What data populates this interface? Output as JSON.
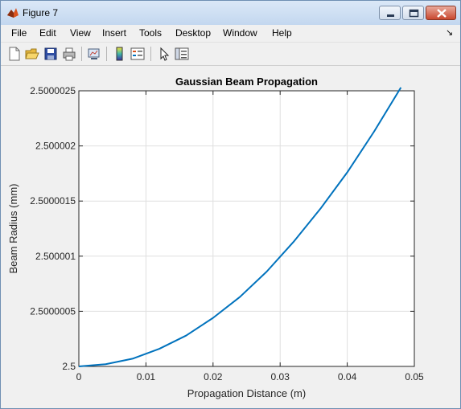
{
  "window": {
    "title": "Figure 7",
    "icon": "matlab-icon",
    "controls": [
      "minimize-icon",
      "maximize-icon",
      "close-icon"
    ]
  },
  "menubar": {
    "items": [
      "File",
      "Edit",
      "View",
      "Insert",
      "Tools",
      "Desktop",
      "Window",
      "Help"
    ],
    "dock_arrow": "↘"
  },
  "toolbar": {
    "buttons": [
      {
        "name": "new-figure-icon"
      },
      {
        "name": "open-file-icon"
      },
      {
        "name": "save-figure-icon"
      },
      {
        "name": "print-figure-icon"
      },
      {
        "name": "link-plot-icon"
      },
      {
        "name": "insert-colorbar-icon"
      },
      {
        "name": "insert-legend-icon"
      },
      {
        "name": "edit-plot-arrow-icon"
      },
      {
        "name": "show-plot-tools-icon"
      }
    ]
  },
  "colors": {
    "line": "#0072bd",
    "grid": "#dfdfdf",
    "figure_bg": "#f0f0f0",
    "axes_bg": "#ffffff"
  },
  "chart_data": {
    "type": "line",
    "title": "Gaussian Beam Propagation",
    "xlabel": "Propagation Distance (m)",
    "ylabel": "Beam Radius (mm)",
    "xlim": [
      0,
      0.05
    ],
    "ylim": [
      2.5,
      2.5000025
    ],
    "xticks": [
      0,
      0.01,
      0.02,
      0.03,
      0.04,
      0.05
    ],
    "xtick_labels": [
      "0",
      "0.01",
      "0.02",
      "0.03",
      "0.04",
      "0.05"
    ],
    "yticks": [
      2.5,
      2.5000005,
      2.500001,
      2.5000015,
      2.500002,
      2.5000025
    ],
    "ytick_labels": [
      "2.5",
      "2.5000005",
      "2.500001",
      "2.5000015",
      "2.500002",
      "2.5000025"
    ],
    "grid": true,
    "series": [
      {
        "x": [
          0,
          0.004,
          0.008,
          0.012,
          0.016,
          0.02,
          0.024,
          0.028,
          0.032,
          0.036,
          0.04,
          0.044,
          0.048
        ],
        "y": [
          2.5,
          2.50000002,
          2.50000007,
          2.50000016,
          2.50000028,
          2.50000044,
          2.50000063,
          2.50000086,
          2.50000113,
          2.50000143,
          2.50000176,
          2.50000213,
          2.50000253
        ]
      }
    ]
  }
}
